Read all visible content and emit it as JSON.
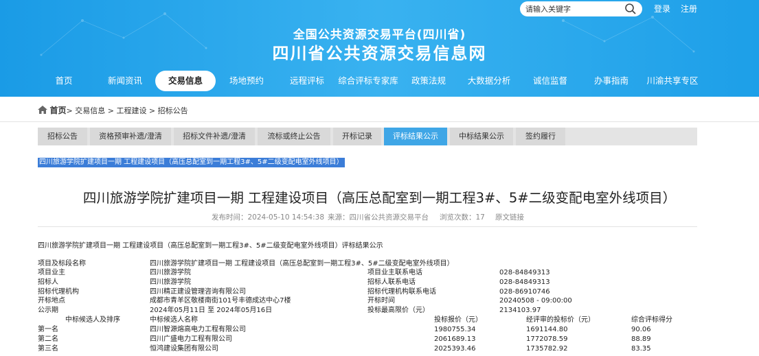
{
  "header": {
    "search_placeholder": "请输入关键字",
    "login": "登录",
    "register": "注册",
    "title_small": "全国公共资源交易平台(四川省)",
    "title_big": "四川省公共资源交易信息网",
    "nav": [
      "首页",
      "新闻资讯",
      "交易信息",
      "场地预约",
      "远程评标",
      "综合评标专家库",
      "政策法规",
      "大数据分析",
      "诚信监督",
      "办事指南",
      "川渝共享专区"
    ],
    "nav_active": 2
  },
  "breadcrumb": {
    "home": "首页",
    "path": "> 交易信息 > 工程建设 > 招标公告"
  },
  "subtabs": [
    "招标公告",
    "资格预审补遗/澄清",
    "招标文件补遗/澄清",
    "流标或终止公告",
    "开标记录",
    "评标结果公示",
    "中标结果公示",
    "签约履行"
  ],
  "subtab_active": 5,
  "highlight": "四川旅游学院扩建项目一期 工程建设项目（高压总配室到一期工程3#、5#二级变配电室外线项目）",
  "article": {
    "title": "四川旅游学院扩建项目一期 工程建设项目（高压总配室到一期工程3#、5#二级变配电室外线项目）",
    "publish_time": "发布时间：2024-05-10 14:54:38",
    "source": "来源：四川省公共资源交易平台",
    "views": "浏览次数：17",
    "origin_link": "原文链接",
    "doc_title": "四川旅游学院扩建项目一期 工程建设项目（高压总配室到一期工程3#、5#二级变配电室外线项目）评标结果公示"
  },
  "info": {
    "project_label": "项目及标段名称",
    "project_value": "四川旅游学院扩建项目一期 工程建设项目（高压总配室到一期工程3#、5#二级变配电室外线项目）",
    "rows": [
      {
        "l1": "项目业主",
        "v1": "四川旅游学院",
        "l2": "项目业主联系电话",
        "v2": "028-84849313"
      },
      {
        "l1": "招标人",
        "v1": "四川旅游学院",
        "l2": "招标人联系电话",
        "v2": "028-84849313"
      },
      {
        "l1": "招标代理机构",
        "v1": "四川精正建设管理咨询有限公司",
        "l2": "招标代理机构联系电话",
        "v2": "028-86910746"
      },
      {
        "l1": "开标地点",
        "v1": "成都市青羊区敬楼南街101号丰德成达中心7楼",
        "l2": "开标时间",
        "v2": "20240508 - 09:00:00"
      },
      {
        "l1": "公示期",
        "v1": "2024年05月11日 至 2024年05月16日",
        "l2": "投标最高限价（元）",
        "v2": "2134103.97"
      }
    ]
  },
  "candidates": {
    "headers": [
      "中标候选人及排序",
      "中标候选人名称",
      "投标报价（元）",
      "经评审的投标价（元）",
      "综合评标得分"
    ],
    "rows": [
      {
        "rank": "第一名",
        "name": "四川智源熔高电力工程有限公司",
        "bid": "1980755.34",
        "eval": "1691144.80",
        "score": "90.06"
      },
      {
        "rank": "第二名",
        "name": "四川广盛电力工程有限公司",
        "bid": "2061689.13",
        "eval": "1772078.59",
        "score": "88.89"
      },
      {
        "rank": "第三名",
        "name": "恒鸿建设集团有限公司",
        "bid": "2025393.46",
        "eval": "1735782.92",
        "score": "83.35"
      }
    ]
  }
}
